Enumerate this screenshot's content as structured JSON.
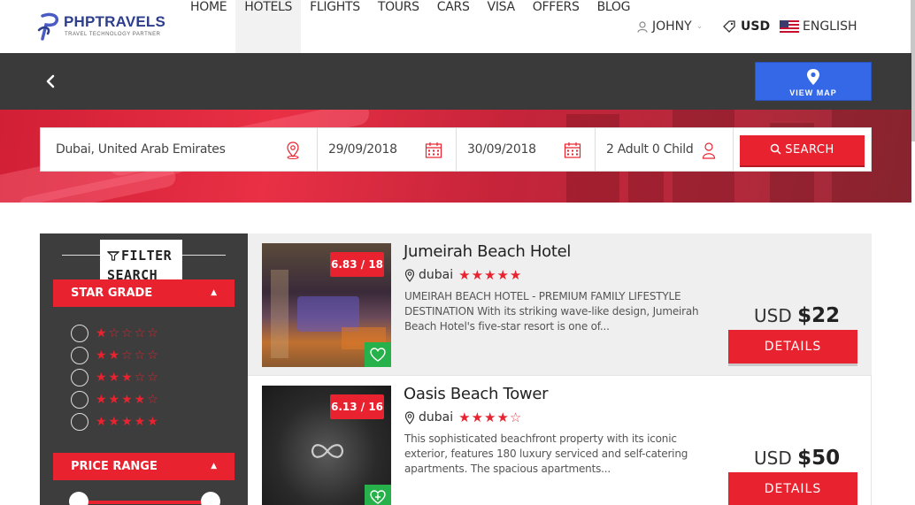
{
  "brand": {
    "name": "PHPTRAVELS",
    "tagline": "TRAVEL TECHNOLOGY PARTNER"
  },
  "nav": {
    "items": [
      {
        "label": "HOME"
      },
      {
        "label": "HOTELS"
      },
      {
        "label": "FLIGHTS"
      },
      {
        "label": "TOURS"
      },
      {
        "label": "CARS"
      },
      {
        "label": "VISA"
      },
      {
        "label": "OFFERS"
      },
      {
        "label": "BLOG"
      }
    ],
    "active": "HOTELS"
  },
  "account": {
    "user": "JOHNY",
    "currency": "USD",
    "language": "ENGLISH"
  },
  "toolbar": {
    "view_map_label": "VIEW MAP"
  },
  "search": {
    "destination": "Dubai, United Arab Emirates",
    "checkin": "29/09/2018",
    "checkout": "30/09/2018",
    "guests": "2 Adult 0 Child",
    "button_label": "SEARCH"
  },
  "filters": {
    "title": "FILTER SEARCH",
    "star_grade_label": "STAR GRADE",
    "star_options": [
      1,
      2,
      3,
      4,
      5
    ],
    "price_range_label": "PRICE RANGE"
  },
  "hotels": [
    {
      "name": "Jumeirah Beach Hotel",
      "location": "dubai",
      "stars": 5,
      "score": "6.83 / 18",
      "description": "UMEIRAH BEACH HOTEL - PREMIUM FAMILY LIFESTYLE DESTINATION With its striking wave-like design, Jumeirah Beach Hotel's five-star resort is one of...",
      "currency": "USD",
      "price": "$22",
      "details_label": "DETAILS"
    },
    {
      "name": "Oasis Beach Tower",
      "location": "dubai",
      "stars": 4,
      "score": "6.13 / 16",
      "description": "This sophisticated beachfront property with its iconic exterior, features 180 luxury serviced and self-catering apartments. The spacious apartments...",
      "currency": "USD",
      "price": "$50",
      "details_label": "DETAILS"
    }
  ],
  "colors": {
    "accent": "#e8232f",
    "map_button": "#3568e6",
    "dark_bar": "#3a3a3a",
    "sidebar": "#3d3d3d",
    "wishlist": "#27b14a"
  },
  "icons": [
    "user-icon",
    "tag-icon",
    "us-flag-icon",
    "back-arrow-icon",
    "map-pin-icon",
    "calendar-icon",
    "person-icon",
    "search-icon",
    "filter-icon",
    "heart-icon",
    "location-icon"
  ]
}
